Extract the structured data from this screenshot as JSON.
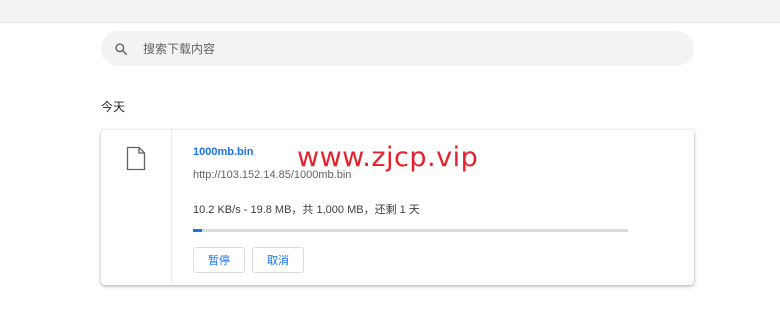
{
  "search": {
    "placeholder": "搜索下载内容",
    "icon": "search-icon"
  },
  "section": {
    "title": "今天"
  },
  "download": {
    "filename": "1000mb.bin",
    "url": "http://103.152.14.85/1000mb.bin",
    "status": "10.2 KB/s - 19.8 MB，共 1,000 MB，还剩 1 天",
    "progress_percent": 2,
    "file_icon": "file-icon",
    "pause_label": "暂停",
    "cancel_label": "取消"
  },
  "watermark": {
    "text": "www.zjcp.vip"
  },
  "colors": {
    "accent": "#1a73e8",
    "watermark": "#e8202a"
  }
}
